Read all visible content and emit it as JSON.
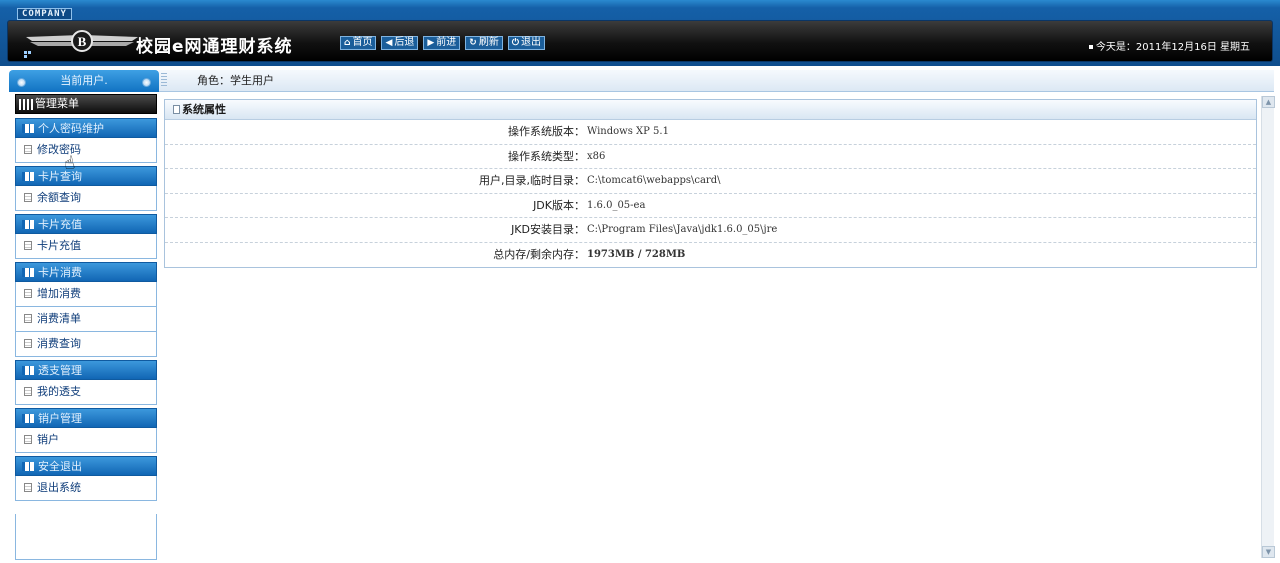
{
  "header": {
    "company": "COMPANY",
    "system_title": "校园e网通理财系统",
    "toolbar": [
      {
        "icon": "home-icon",
        "glyph": "⌂",
        "label": "首页"
      },
      {
        "icon": "back-icon",
        "glyph": "◀",
        "label": "后退"
      },
      {
        "icon": "forward-icon",
        "glyph": "▶",
        "label": "前进"
      },
      {
        "icon": "refresh-icon",
        "glyph": "↻",
        "label": "刷新"
      },
      {
        "icon": "power-icon",
        "glyph": "⏻",
        "label": "退出"
      }
    ],
    "today": "今天是：2011年12月16日 星期五"
  },
  "sidebar": {
    "current_user_label": "当前用户.",
    "menu_title": "管理菜单",
    "groups": [
      {
        "title": "个人密码维护",
        "items": [
          "修改密码"
        ]
      },
      {
        "title": "卡片查询",
        "items": [
          "余额查询"
        ]
      },
      {
        "title": "卡片充值",
        "items": [
          "卡片充值"
        ]
      },
      {
        "title": "卡片消费",
        "items": [
          "增加消费",
          "消费清单",
          "消费查询"
        ]
      },
      {
        "title": "透支管理",
        "items": [
          "我的透支"
        ]
      },
      {
        "title": "销户管理",
        "items": [
          "销户"
        ]
      },
      {
        "title": "安全退出",
        "items": [
          "退出系统"
        ]
      }
    ]
  },
  "role_bar": {
    "text": "角色：学生用户"
  },
  "panel": {
    "title": "系统属性",
    "rows": [
      {
        "label": "操作系统版本：",
        "value": "Windows XP  5.1"
      },
      {
        "label": "操作系统类型：",
        "value": "x86"
      },
      {
        "label": "用户,目录,临时目录：",
        "value": "C:\\tomcat6\\webapps\\card\\"
      },
      {
        "label": "JDK版本：",
        "value": "1.6.0_05-ea"
      },
      {
        "label": "JKD安装目录：",
        "value": "C:\\Program Files\\Java\\jdk1.6.0_05\\jre"
      },
      {
        "label": "总内存/剩余内存：",
        "value": "1973MB / 728MB"
      }
    ]
  },
  "colors": {
    "header_blue": "#1560a8",
    "accent_blue": "#1166b4",
    "link_text": "#0f3d7a"
  }
}
